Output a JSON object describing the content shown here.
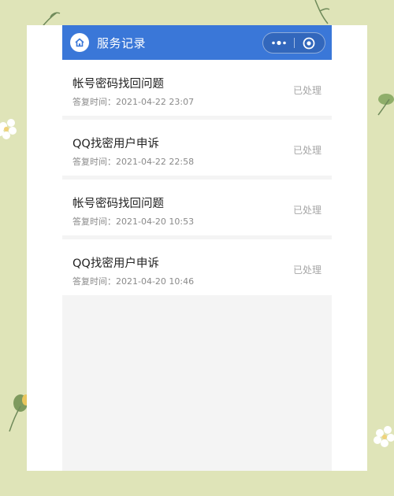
{
  "navbar": {
    "title": "服务记录",
    "home_icon": "home-icon",
    "more_icon": "more-dots-icon",
    "close_icon": "target-close-icon",
    "background_color": "#3a77d8"
  },
  "records": [
    {
      "title": "帐号密码找回问题",
      "time_label": "答复时间：",
      "time": "2021-04-22 23:07",
      "status": "已处理"
    },
    {
      "title": "QQ找密用户申诉",
      "time_label": "答复时间：",
      "time": "2021-04-22 22:58",
      "status": "已处理"
    },
    {
      "title": "帐号密码找回问题",
      "time_label": "答复时间：",
      "time": "2021-04-20 10:53",
      "status": "已处理"
    },
    {
      "title": "QQ找密用户申诉",
      "time_label": "答复时间：",
      "time": "2021-04-20 10:46",
      "status": "已处理"
    }
  ]
}
